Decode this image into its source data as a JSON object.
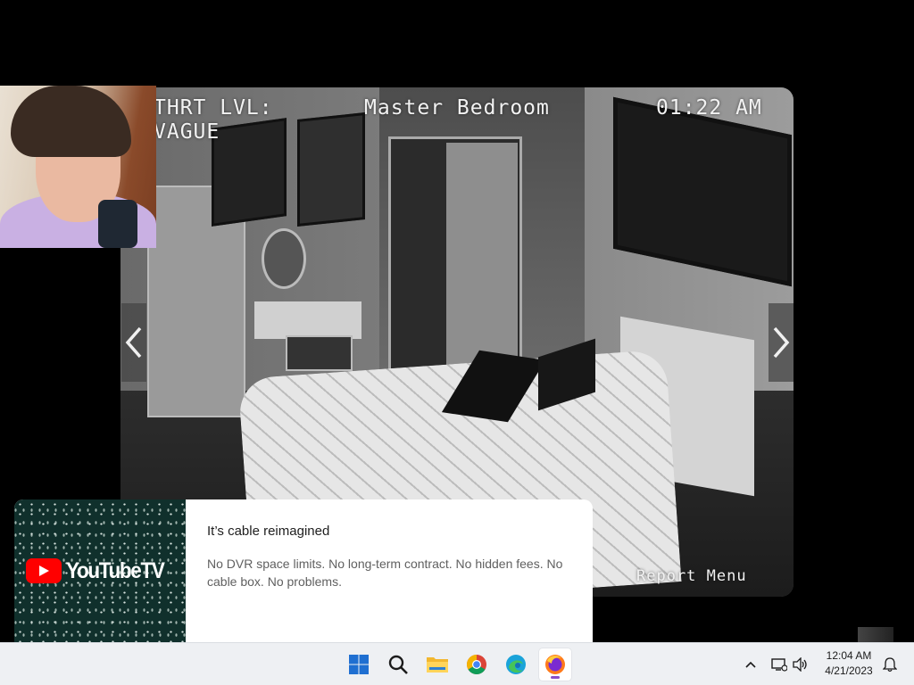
{
  "camera": {
    "threat_label_line1": "THRT LVL:",
    "threat_label_line2": "VAGUE",
    "room_name": "Master Bedroom",
    "time": "01:22 AM",
    "report_menu": "Report Menu",
    "nav": {
      "prev_icon": "chevron-left-icon",
      "next_icon": "chevron-right-icon"
    }
  },
  "ad": {
    "brand": "YouTubeTV",
    "title": "It’s cable reimagined",
    "body": "No DVR space limits. No long-term contract. No hidden fees. No cable box. No problems."
  },
  "taskbar": {
    "apps": [
      "windows-start-icon",
      "search-icon",
      "file-explorer-icon",
      "chrome-icon",
      "edge-icon",
      "firefox-icon"
    ],
    "active_app": "firefox",
    "active_indicator_color": "#8a4dc9",
    "clock_time": "12:04 AM",
    "clock_date": "4/21/2023"
  },
  "colors": {
    "ad_brand_red": "#ff0000",
    "taskbar_bg": "#eef0f3"
  }
}
